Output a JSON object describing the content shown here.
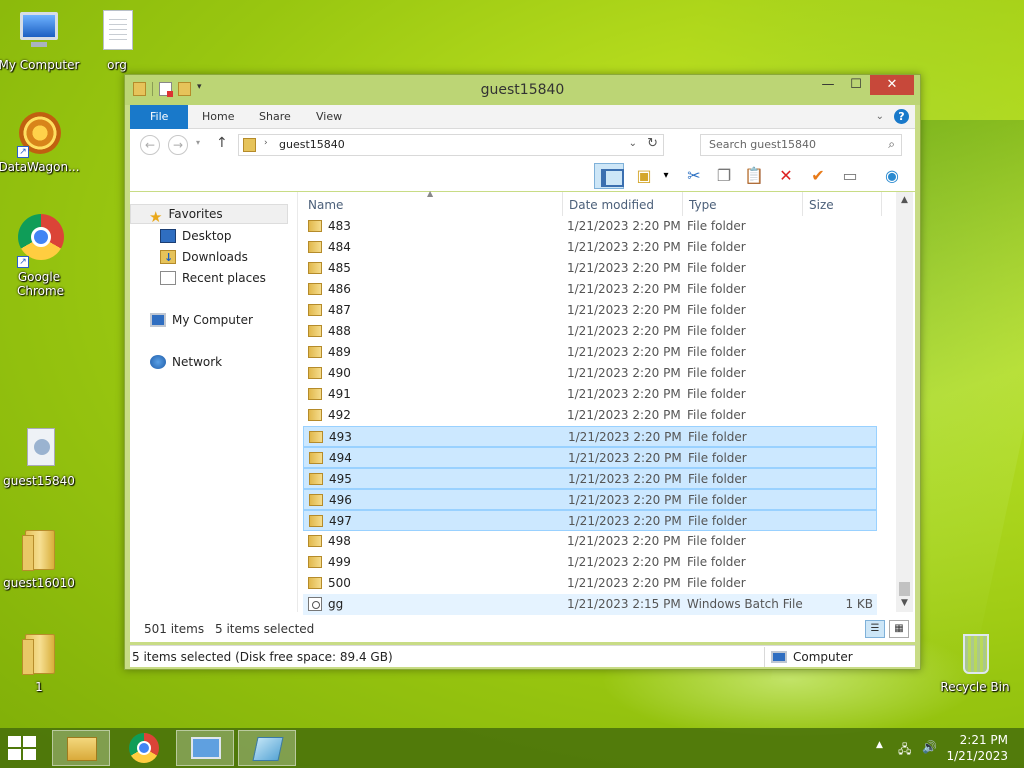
{
  "desktop": {
    "icons": [
      {
        "label": "My Computer"
      },
      {
        "label": "org"
      },
      {
        "label": "DataWagon..."
      },
      {
        "label": "Google Chrome"
      },
      {
        "label": "guest15840"
      },
      {
        "label": "guest16010"
      },
      {
        "label": "1"
      },
      {
        "label": "Recycle Bin"
      }
    ]
  },
  "window": {
    "title": "guest15840",
    "ribbon_tabs": [
      "File",
      "Home",
      "Share",
      "View"
    ],
    "address": {
      "path": "guest15840"
    },
    "search": {
      "placeholder": "Search guest15840"
    },
    "nav_pane": {
      "favorites": "Favorites",
      "items": [
        "Desktop",
        "Downloads",
        "Recent places"
      ],
      "computer": "My Computer",
      "network": "Network"
    },
    "columns": [
      "Name",
      "Date modified",
      "Type",
      "Size"
    ],
    "rows": [
      {
        "name": "483",
        "date": "1/21/2023 2:20 PM",
        "type": "File folder",
        "size": ""
      },
      {
        "name": "484",
        "date": "1/21/2023 2:20 PM",
        "type": "File folder",
        "size": ""
      },
      {
        "name": "485",
        "date": "1/21/2023 2:20 PM",
        "type": "File folder",
        "size": ""
      },
      {
        "name": "486",
        "date": "1/21/2023 2:20 PM",
        "type": "File folder",
        "size": ""
      },
      {
        "name": "487",
        "date": "1/21/2023 2:20 PM",
        "type": "File folder",
        "size": ""
      },
      {
        "name": "488",
        "date": "1/21/2023 2:20 PM",
        "type": "File folder",
        "size": ""
      },
      {
        "name": "489",
        "date": "1/21/2023 2:20 PM",
        "type": "File folder",
        "size": ""
      },
      {
        "name": "490",
        "date": "1/21/2023 2:20 PM",
        "type": "File folder",
        "size": ""
      },
      {
        "name": "491",
        "date": "1/21/2023 2:20 PM",
        "type": "File folder",
        "size": ""
      },
      {
        "name": "492",
        "date": "1/21/2023 2:20 PM",
        "type": "File folder",
        "size": ""
      },
      {
        "name": "493",
        "date": "1/21/2023 2:20 PM",
        "type": "File folder",
        "size": "",
        "selected": true
      },
      {
        "name": "494",
        "date": "1/21/2023 2:20 PM",
        "type": "File folder",
        "size": "",
        "selected": true
      },
      {
        "name": "495",
        "date": "1/21/2023 2:20 PM",
        "type": "File folder",
        "size": "",
        "selected": true
      },
      {
        "name": "496",
        "date": "1/21/2023 2:20 PM",
        "type": "File folder",
        "size": "",
        "selected": true
      },
      {
        "name": "497",
        "date": "1/21/2023 2:20 PM",
        "type": "File folder",
        "size": "",
        "selected": true
      },
      {
        "name": "498",
        "date": "1/21/2023 2:20 PM",
        "type": "File folder",
        "size": ""
      },
      {
        "name": "499",
        "date": "1/21/2023 2:20 PM",
        "type": "File folder",
        "size": ""
      },
      {
        "name": "500",
        "date": "1/21/2023 2:20 PM",
        "type": "File folder",
        "size": ""
      },
      {
        "name": "gg",
        "date": "1/21/2023 2:15 PM",
        "type": "Windows Batch File",
        "size": "1 KB",
        "batch": true
      }
    ],
    "status_inner": {
      "count": "501 items",
      "selected": "5 items selected"
    },
    "status_bar": {
      "left": "5 items selected (Disk free space: 89.4 GB)",
      "right": "Computer"
    }
  },
  "taskbar": {
    "time": "2:21 PM",
    "date": "1/21/2023"
  },
  "icons": {
    "back": "back-arrow-icon",
    "forward": "forward-arrow-icon",
    "up": "up-arrow-icon",
    "refresh": "refresh-icon",
    "search": "search-icon",
    "help": "help-icon",
    "cut": "scissors-icon",
    "copy": "copy-icon",
    "paste": "clipboard-icon",
    "delete": "red-x-icon",
    "properties": "checkmark-icon",
    "rename": "rename-icon",
    "globe": "globe-icon"
  },
  "colors": {
    "titlebar": "#bcd575",
    "selection": "#cce8ff",
    "file_tab": "#1979ca",
    "close_button": "#c7483a"
  }
}
